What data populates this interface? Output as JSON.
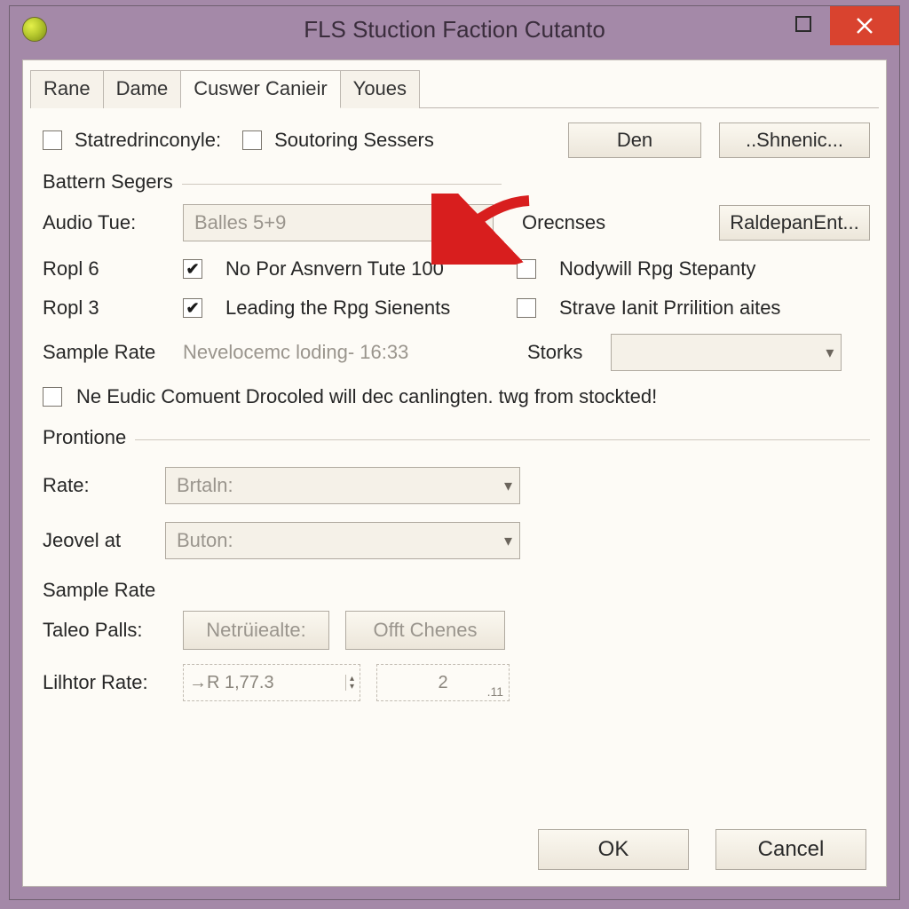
{
  "window": {
    "title": "FLS Stuction Faction Cutanto"
  },
  "tabs": [
    {
      "label": "Rane"
    },
    {
      "label": "Dame"
    },
    {
      "label": "Cuswer Canieir",
      "active": true
    },
    {
      "label": "Youes"
    }
  ],
  "top_row": {
    "cb1_label": "Statredrinconyle:",
    "cb2_label": "Soutoring Sessers",
    "btn_den": "Den",
    "btn_shnenic": "..Shnenic..."
  },
  "battern": {
    "legend": "Battern Segers",
    "audio_label": "Audio Tue:",
    "audio_value": "Balles 5+9",
    "orecnses": "Orecnses",
    "btn_raldepan": "RaldepanEnt...",
    "ropl6": "Ropl 6",
    "ropl6_cb": "No Por Asnvern Tute 100",
    "nodywill": "Nodywill Rpg Stepanty",
    "ropl3": "Ropl 3",
    "ropl3_cb": "Leading the Rpg Sienents",
    "strave": "Strave Ianit Prrilition aites",
    "sample_rate": "Sample Rate",
    "sample_val": "Nevelocemc loding- 16:33",
    "storks": "Storks",
    "warn": "Ne Eudic Comuent Drocoled will dec canlingten. twg from stockted!"
  },
  "prontione": {
    "legend": "Prontione",
    "rate_label": "Rate:",
    "rate_value": "Brtaln:",
    "jeovel_label": "Jeovel at",
    "jeovel_value": "Buton:",
    "sample_rate": "Sample Rate",
    "taleo_label": "Taleo Palls:",
    "btn_netru": "Netrüiealte:",
    "btn_offt": "Offt Chenes",
    "lilhtor_label": "Lilhtor Rate:",
    "spin1": "→R  1,77.3",
    "spin2": "2",
    "spin2_suffix": ".11"
  },
  "footer": {
    "ok": "OK",
    "cancel": "Cancel"
  }
}
